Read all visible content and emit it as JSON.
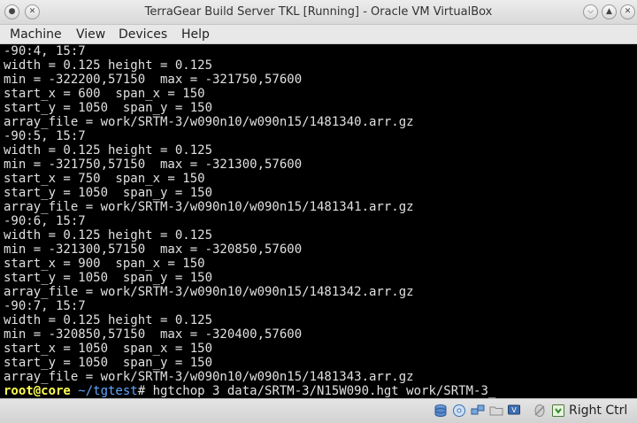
{
  "window": {
    "title": "TerraGear Build  Server TKL [Running] - Oracle VM VirtualBox"
  },
  "menu": [
    "Machine",
    "View",
    "Devices",
    "Help"
  ],
  "terminal": {
    "lines": [
      "-90:4, 15:7",
      "width = 0.125 height = 0.125",
      "min = -322200,57150  max = -321750,57600",
      "start_x = 600  span_x = 150",
      "start_y = 1050  span_y = 150",
      "array_file = work/SRTM-3/w090n10/w090n15/1481340.arr.gz",
      "-90:5, 15:7",
      "width = 0.125 height = 0.125",
      "min = -321750,57150  max = -321300,57600",
      "start_x = 750  span_x = 150",
      "start_y = 1050  span_y = 150",
      "array_file = work/SRTM-3/w090n10/w090n15/1481341.arr.gz",
      "-90:6, 15:7",
      "width = 0.125 height = 0.125",
      "min = -321300,57150  max = -320850,57600",
      "start_x = 900  span_x = 150",
      "start_y = 1050  span_y = 150",
      "array_file = work/SRTM-3/w090n10/w090n15/1481342.arr.gz",
      "-90:7, 15:7",
      "width = 0.125 height = 0.125",
      "min = -320850,57150  max = -320400,57600",
      "start_x = 1050  span_x = 150",
      "start_y = 1050  span_y = 150",
      "array_file = work/SRTM-3/w090n10/w090n15/1481343.arr.gz"
    ],
    "prompt": {
      "user": "root@core",
      "path": " ~/tgtest",
      "symbol": "# ",
      "command": "hgtchop 3 data/SRTM-3/N15W090.hgt work/SRTM-3",
      "cursor": "_"
    }
  },
  "statusbar": {
    "host_key_label": "Right Ctrl",
    "icons": [
      "hard-disk-icon",
      "optical-disk-icon",
      "network-icon",
      "shared-folders-icon",
      "display-icon",
      "mouse-integration-icon",
      "host-key-icon"
    ]
  }
}
